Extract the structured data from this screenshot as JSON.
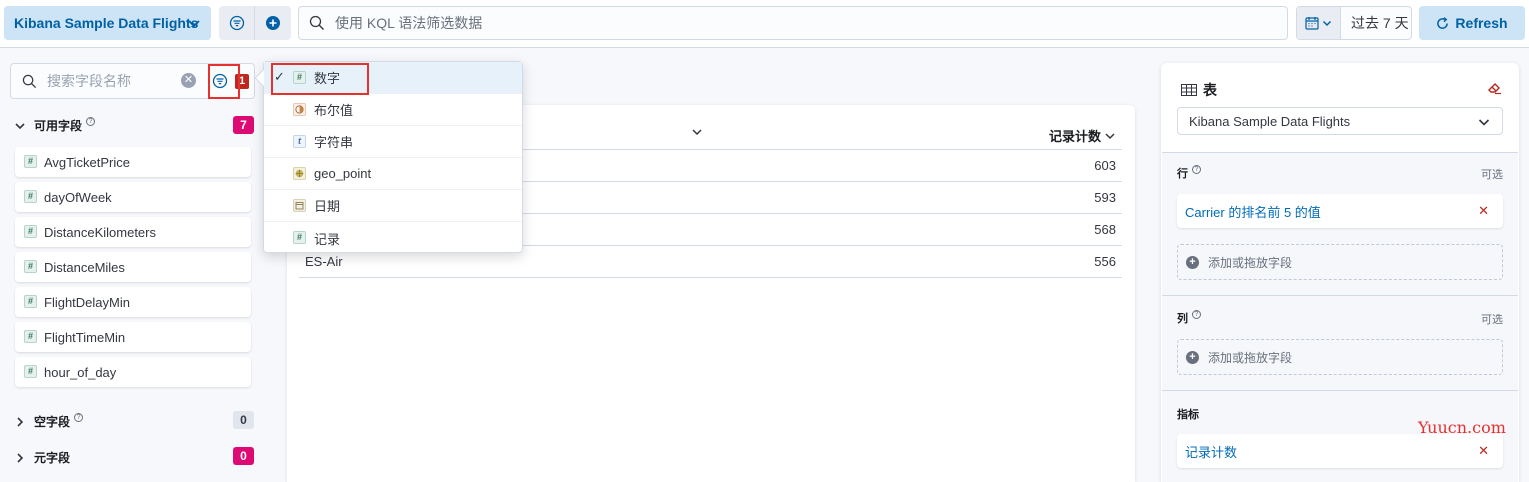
{
  "header": {
    "data_view": "Kibana Sample Data Flights",
    "query_placeholder": "使用 KQL 语法筛选数据",
    "date_range": "过去 7 天",
    "refresh": "Refresh"
  },
  "fields_panel": {
    "search_placeholder": "搜索字段名称",
    "filter_count": "1",
    "groups": {
      "available": {
        "label": "可用字段",
        "count": "7"
      },
      "empty": {
        "label": "空字段",
        "count": "0"
      },
      "meta": {
        "label": "元字段",
        "count": "0"
      }
    },
    "fields": [
      "AvgTicketPrice",
      "dayOfWeek",
      "DistanceKilometers",
      "DistanceMiles",
      "FlightDelayMin",
      "FlightTimeMin",
      "hour_of_day"
    ]
  },
  "type_filter": {
    "items": [
      {
        "label": "数字",
        "icon": "number-token-icon",
        "selected": true
      },
      {
        "label": "布尔值",
        "icon": "boolean-token-icon",
        "selected": false
      },
      {
        "label": "字符串",
        "icon": "string-token-icon",
        "selected": false
      },
      {
        "label": "geo_point",
        "icon": "geo-token-icon",
        "selected": false
      },
      {
        "label": "日期",
        "icon": "date-token-icon",
        "selected": false
      },
      {
        "label": "记录",
        "icon": "record-token-icon",
        "selected": false
      }
    ]
  },
  "table": {
    "metric_header": "记录计数",
    "rows": [
      {
        "name": "",
        "value": "603"
      },
      {
        "name": "",
        "value": "593"
      },
      {
        "name": "",
        "value": "568"
      },
      {
        "name": "ES-Air",
        "value": "556"
      }
    ]
  },
  "config_panel": {
    "title": "表",
    "data_view": "Kibana Sample Data Flights",
    "rows": {
      "label": "行",
      "optional": "可选",
      "dimension": "Carrier 的排名前 5 的值",
      "add": "添加或拖放字段"
    },
    "columns": {
      "label": "列",
      "optional": "可选",
      "add": "添加或拖放字段"
    },
    "metrics": {
      "label": "指标",
      "dimension": "记录计数"
    }
  },
  "watermark": "Yuucn.com",
  "colors": {
    "accent": "#0061a6",
    "accent_bg": "#cce4f5",
    "highlight_red": "#e7312e",
    "badge_pink": "#dd0a73"
  }
}
